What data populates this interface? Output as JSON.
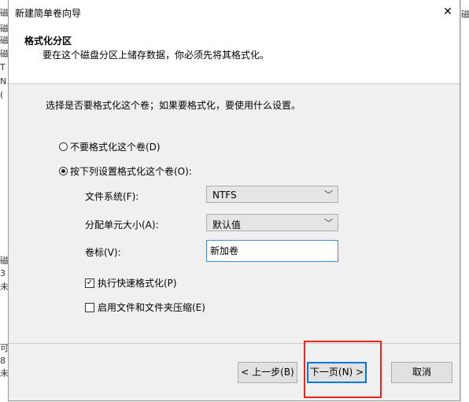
{
  "background": {
    "left_fragments": [
      "磁",
      "磁",
      "磁",
      "磁",
      "T",
      "N",
      "(",
      "磁",
      "3",
      "未",
      "可",
      "8",
      "未"
    ],
    "right_fragment": "磁"
  },
  "dialog": {
    "title": "新建简单卷向导",
    "close_glyph": "✕",
    "header_title": "格式化分区",
    "header_subtitle": "要在这个磁盘分区上储存数据，你必须先将其格式化。",
    "prompt": "选择是否要格式化这个卷；如果要格式化，要使用什么设置。",
    "option_no_format": "不要格式化这个卷(D)",
    "option_format": "按下列设置格式化这个卷(O):",
    "file_system_label": "文件系统(F):",
    "file_system_value": "NTFS",
    "allocation_label": "分配单元大小(A):",
    "allocation_value": "默认值",
    "volume_label_label": "卷标(V):",
    "volume_label_value": "新加卷",
    "quick_format_label": "执行快速格式化(P)",
    "compression_label": "启用文件和文件夹压缩(E)",
    "back_button": "< 上一步(B)",
    "next_button": "下一页(N) >",
    "cancel_button": "取消",
    "arrow_glyph": "﹀",
    "check_glyph": "✓"
  }
}
